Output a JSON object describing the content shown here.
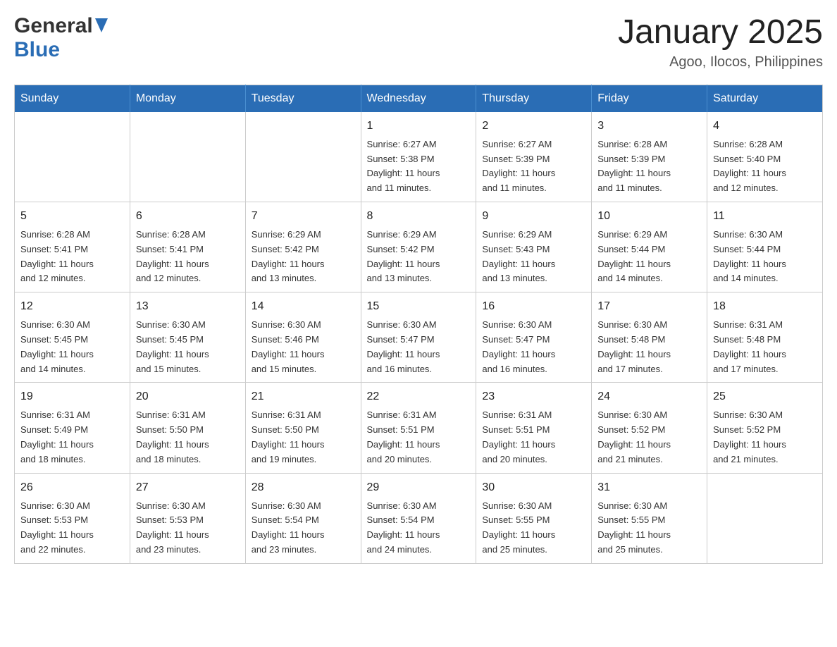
{
  "header": {
    "logo_general": "General",
    "logo_blue": "Blue",
    "month_title": "January 2025",
    "location": "Agoo, Ilocos, Philippines"
  },
  "days_of_week": [
    "Sunday",
    "Monday",
    "Tuesday",
    "Wednesday",
    "Thursday",
    "Friday",
    "Saturday"
  ],
  "weeks": [
    {
      "days": [
        {
          "number": "",
          "info": ""
        },
        {
          "number": "",
          "info": ""
        },
        {
          "number": "",
          "info": ""
        },
        {
          "number": "1",
          "info": "Sunrise: 6:27 AM\nSunset: 5:38 PM\nDaylight: 11 hours\nand 11 minutes."
        },
        {
          "number": "2",
          "info": "Sunrise: 6:27 AM\nSunset: 5:39 PM\nDaylight: 11 hours\nand 11 minutes."
        },
        {
          "number": "3",
          "info": "Sunrise: 6:28 AM\nSunset: 5:39 PM\nDaylight: 11 hours\nand 11 minutes."
        },
        {
          "number": "4",
          "info": "Sunrise: 6:28 AM\nSunset: 5:40 PM\nDaylight: 11 hours\nand 12 minutes."
        }
      ]
    },
    {
      "days": [
        {
          "number": "5",
          "info": "Sunrise: 6:28 AM\nSunset: 5:41 PM\nDaylight: 11 hours\nand 12 minutes."
        },
        {
          "number": "6",
          "info": "Sunrise: 6:28 AM\nSunset: 5:41 PM\nDaylight: 11 hours\nand 12 minutes."
        },
        {
          "number": "7",
          "info": "Sunrise: 6:29 AM\nSunset: 5:42 PM\nDaylight: 11 hours\nand 13 minutes."
        },
        {
          "number": "8",
          "info": "Sunrise: 6:29 AM\nSunset: 5:42 PM\nDaylight: 11 hours\nand 13 minutes."
        },
        {
          "number": "9",
          "info": "Sunrise: 6:29 AM\nSunset: 5:43 PM\nDaylight: 11 hours\nand 13 minutes."
        },
        {
          "number": "10",
          "info": "Sunrise: 6:29 AM\nSunset: 5:44 PM\nDaylight: 11 hours\nand 14 minutes."
        },
        {
          "number": "11",
          "info": "Sunrise: 6:30 AM\nSunset: 5:44 PM\nDaylight: 11 hours\nand 14 minutes."
        }
      ]
    },
    {
      "days": [
        {
          "number": "12",
          "info": "Sunrise: 6:30 AM\nSunset: 5:45 PM\nDaylight: 11 hours\nand 14 minutes."
        },
        {
          "number": "13",
          "info": "Sunrise: 6:30 AM\nSunset: 5:45 PM\nDaylight: 11 hours\nand 15 minutes."
        },
        {
          "number": "14",
          "info": "Sunrise: 6:30 AM\nSunset: 5:46 PM\nDaylight: 11 hours\nand 15 minutes."
        },
        {
          "number": "15",
          "info": "Sunrise: 6:30 AM\nSunset: 5:47 PM\nDaylight: 11 hours\nand 16 minutes."
        },
        {
          "number": "16",
          "info": "Sunrise: 6:30 AM\nSunset: 5:47 PM\nDaylight: 11 hours\nand 16 minutes."
        },
        {
          "number": "17",
          "info": "Sunrise: 6:30 AM\nSunset: 5:48 PM\nDaylight: 11 hours\nand 17 minutes."
        },
        {
          "number": "18",
          "info": "Sunrise: 6:31 AM\nSunset: 5:48 PM\nDaylight: 11 hours\nand 17 minutes."
        }
      ]
    },
    {
      "days": [
        {
          "number": "19",
          "info": "Sunrise: 6:31 AM\nSunset: 5:49 PM\nDaylight: 11 hours\nand 18 minutes."
        },
        {
          "number": "20",
          "info": "Sunrise: 6:31 AM\nSunset: 5:50 PM\nDaylight: 11 hours\nand 18 minutes."
        },
        {
          "number": "21",
          "info": "Sunrise: 6:31 AM\nSunset: 5:50 PM\nDaylight: 11 hours\nand 19 minutes."
        },
        {
          "number": "22",
          "info": "Sunrise: 6:31 AM\nSunset: 5:51 PM\nDaylight: 11 hours\nand 20 minutes."
        },
        {
          "number": "23",
          "info": "Sunrise: 6:31 AM\nSunset: 5:51 PM\nDaylight: 11 hours\nand 20 minutes."
        },
        {
          "number": "24",
          "info": "Sunrise: 6:30 AM\nSunset: 5:52 PM\nDaylight: 11 hours\nand 21 minutes."
        },
        {
          "number": "25",
          "info": "Sunrise: 6:30 AM\nSunset: 5:52 PM\nDaylight: 11 hours\nand 21 minutes."
        }
      ]
    },
    {
      "days": [
        {
          "number": "26",
          "info": "Sunrise: 6:30 AM\nSunset: 5:53 PM\nDaylight: 11 hours\nand 22 minutes."
        },
        {
          "number": "27",
          "info": "Sunrise: 6:30 AM\nSunset: 5:53 PM\nDaylight: 11 hours\nand 23 minutes."
        },
        {
          "number": "28",
          "info": "Sunrise: 6:30 AM\nSunset: 5:54 PM\nDaylight: 11 hours\nand 23 minutes."
        },
        {
          "number": "29",
          "info": "Sunrise: 6:30 AM\nSunset: 5:54 PM\nDaylight: 11 hours\nand 24 minutes."
        },
        {
          "number": "30",
          "info": "Sunrise: 6:30 AM\nSunset: 5:55 PM\nDaylight: 11 hours\nand 25 minutes."
        },
        {
          "number": "31",
          "info": "Sunrise: 6:30 AM\nSunset: 5:55 PM\nDaylight: 11 hours\nand 25 minutes."
        },
        {
          "number": "",
          "info": ""
        }
      ]
    }
  ]
}
